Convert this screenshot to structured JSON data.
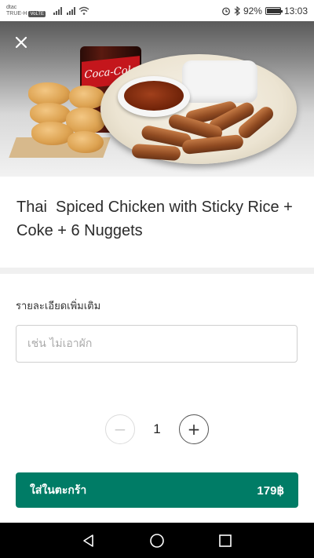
{
  "status_bar": {
    "carrier_top": "dtac",
    "carrier_bottom": "TRUE-H",
    "volte": "VoLTE",
    "battery": "92%",
    "battery_level": 0.92,
    "time": "13:03",
    "icons": [
      "signal-icon",
      "wifi-icon",
      "alarm-icon",
      "bluetooth-icon",
      "battery-icon"
    ]
  },
  "hero": {
    "cup_brand": "Coca-Cola",
    "close_icon": "close-icon"
  },
  "product": {
    "title": "Thai  Spiced Chicken with Sticky Rice + Coke + 6 Nuggets"
  },
  "details": {
    "label": "รายละเอียดเพิ่มเติม",
    "placeholder": "เช่น ไม่เอาผัก",
    "value": ""
  },
  "quantity": {
    "minus": "−",
    "value": "1",
    "plus": "+"
  },
  "cart_button": {
    "label": "ใส่ในตะกร้า",
    "price": "179฿",
    "color": "#007c66"
  },
  "nav": {
    "icons": [
      "back-icon",
      "home-icon",
      "recents-icon"
    ]
  }
}
